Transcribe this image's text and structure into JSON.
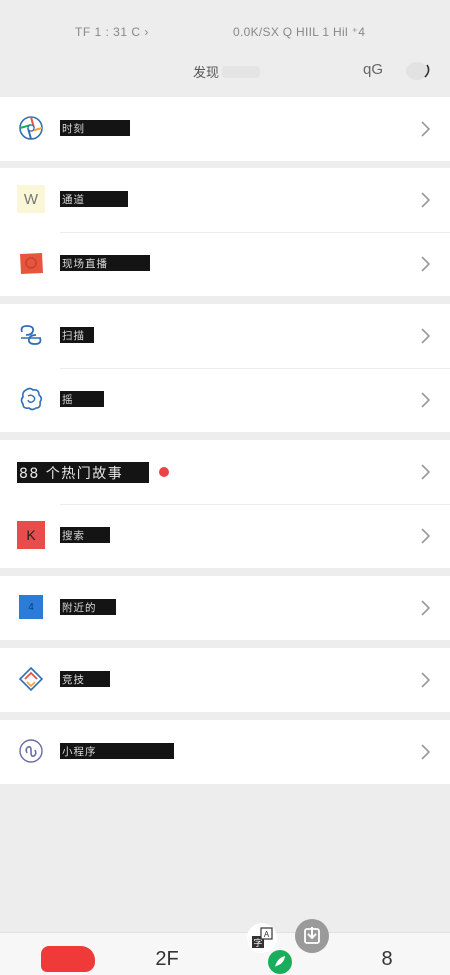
{
  "status_bar": {
    "left_text": "TF 1 : 31 C ›",
    "right_text": "0.0K/SX Q HIIL 1 Hil ⁺4"
  },
  "header": {
    "title": "发现",
    "right_text": "qG"
  },
  "groups": [
    {
      "items": [
        {
          "label": "时刻",
          "icon": "moments-icon"
        }
      ]
    },
    {
      "items": [
        {
          "label": "通道",
          "icon": "channels-icon",
          "icon_text": "W"
        },
        {
          "label": "现场直播",
          "icon": "live-icon"
        }
      ]
    },
    {
      "items": [
        {
          "label": "扫描",
          "icon": "scan-icon"
        },
        {
          "label": "摇",
          "icon": "shake-icon"
        }
      ]
    },
    {
      "items": [
        {
          "label": "88 个热门故事",
          "icon": "none",
          "badge": "red-dot"
        },
        {
          "label": "搜索",
          "icon": "search-icon",
          "icon_text": "K"
        }
      ]
    },
    {
      "items": [
        {
          "label": "附近的",
          "icon": "nearby-icon",
          "icon_text": "4"
        }
      ]
    },
    {
      "items": [
        {
          "label": "竞技",
          "icon": "games-icon"
        }
      ]
    },
    {
      "items": [
        {
          "label": "小程序",
          "icon": "mini-programs-icon"
        }
      ]
    }
  ],
  "tab_bar": {
    "tabs": [
      {
        "label": "",
        "icon": "chats-icon"
      },
      {
        "label": "2F",
        "icon": "contacts-icon"
      },
      {
        "label": "",
        "icon": "discover-icon"
      },
      {
        "label": "8",
        "icon": "me-icon"
      }
    ]
  },
  "overlays": {
    "translate": "translate-icon",
    "download": "download-icon"
  },
  "colors": {
    "background": "#ededed",
    "card": "#ffffff",
    "label_box": "#141414",
    "badge_red": "#e84545",
    "accent_green": "#1aad5b",
    "search_red": "#e94c4c",
    "nearby_blue": "#2b7bd8",
    "live_red": "#e8553f"
  }
}
